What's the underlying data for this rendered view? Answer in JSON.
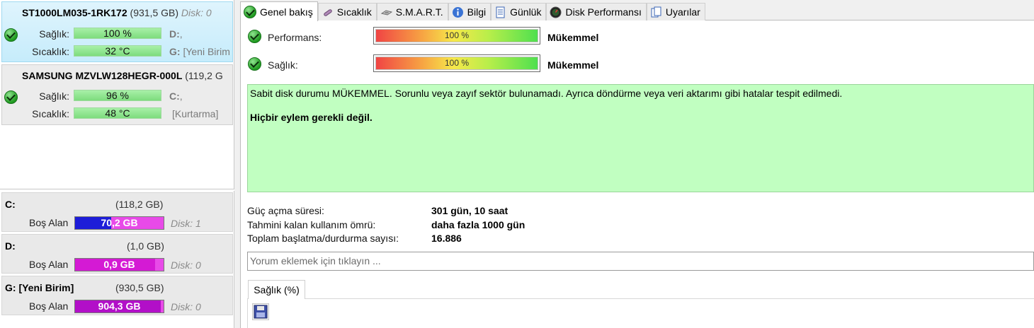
{
  "disks": [
    {
      "model": "ST1000LM035-1RK172",
      "size": "(931,5 GB)",
      "disk_label": "Disk: 0",
      "health_label": "Sağlık:",
      "health_value": "100 %",
      "temp_label": "Sıcaklık:",
      "temp_value": "32 °C",
      "vol_1": "D:",
      "vol_1_rest": ",",
      "vol_2": "G:",
      "vol_2_rest": " [Yeni Birim"
    },
    {
      "model": "SAMSUNG MZVLW128HEGR-000L",
      "size": "(119,2 G",
      "health_label": "Sağlık:",
      "health_value": "96 %",
      "temp_label": "Sıcaklık:",
      "temp_value": "48 °C",
      "vol_1": "C:",
      "vol_1_rest": ",",
      "vol_2": "",
      "vol_2_rest": "[Kurtarma]"
    }
  ],
  "volumes": [
    {
      "name": "C:",
      "size": "(118,2 GB)",
      "free_label": "Boş Alan",
      "free_value": "70,2 GB",
      "disk": "Disk: 1",
      "free_fraction": 0.41,
      "fill_color": "#1d1dd8"
    },
    {
      "name": "D:",
      "size": "(1,0 GB)",
      "free_label": "Boş Alan",
      "free_value": "0,9 GB",
      "disk": "Disk: 0",
      "free_fraction": 0.9,
      "fill_color": "#d41ad4"
    },
    {
      "name": "G: [Yeni Birim]",
      "size": "(930,5 GB)",
      "free_label": "Boş Alan",
      "free_value": "904,3 GB",
      "disk": "Disk: 0",
      "free_fraction": 0.97,
      "fill_color": "#b20fc8"
    }
  ],
  "tabs": [
    {
      "label": "Genel bakış",
      "icon": "check-icon",
      "active": true
    },
    {
      "label": "Sıcaklık",
      "icon": "thermometer-icon",
      "active": false
    },
    {
      "label": "S.M.A.R.T.",
      "icon": "disk-drive-icon",
      "active": false
    },
    {
      "label": "Bilgi",
      "icon": "info-icon",
      "active": false
    },
    {
      "label": "Günlük",
      "icon": "log-icon",
      "active": false
    },
    {
      "label": "Disk Performansı",
      "icon": "gauge-icon",
      "active": false
    },
    {
      "label": "Uyarılar",
      "icon": "alerts-icon",
      "active": false
    }
  ],
  "overview": {
    "performance_label": "Performans:",
    "performance_value": "100 %",
    "performance_status": "Mükemmel",
    "health_label": "Sağlık:",
    "health_value": "100 %",
    "health_status": "Mükemmel",
    "message": "Sabit disk durumu MÜKEMMEL. Sorunlu veya zayıf sektör bulunamadı. Ayrıca döndürme veya veri aktarımı gibi hatalar tespit edilmedi.",
    "action": "Hiçbir eylem gerekli değil.",
    "power_on_label": "Güç açma süresi:",
    "power_on_value": "301 gün, 10 saat",
    "lifetime_label": "Tahmini kalan kullanım ömrü:",
    "lifetime_value": "daha fazla 1000 gün",
    "start_stop_label": "Toplam başlatma/durdurma sayısı:",
    "start_stop_value": "16.886",
    "comment_placeholder": "Yorum eklemek için tıklayın ...",
    "sub_tab": "Sağlık (%)"
  },
  "colors": {
    "selected_card": "#c6ecfb",
    "message_bg": "#c1ffc1",
    "mini_bar": "#7ddc7d"
  }
}
